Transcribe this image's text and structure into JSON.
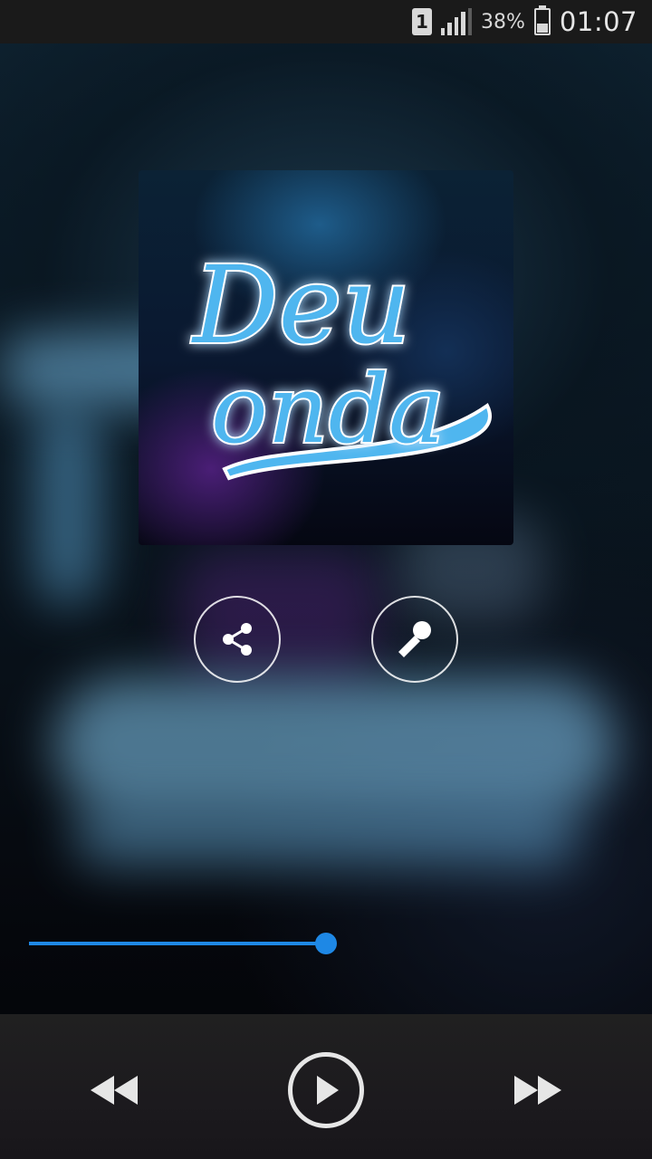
{
  "status_bar": {
    "sim_slot": "1",
    "battery_percent": "38%",
    "time": "01:07"
  },
  "album": {
    "art_title_line1": "Deu",
    "art_title_line2": "onda",
    "accent_color": "#4fb6ef"
  },
  "actions": {
    "share_icon": "share-icon",
    "lyrics_icon": "microphone-icon"
  },
  "playback": {
    "progress_fraction": 0.5,
    "state": "paused",
    "accent_color": "#1e88e5"
  },
  "controls": {
    "rewind_icon": "rewind-icon",
    "play_icon": "play-icon",
    "forward_icon": "fast-forward-icon"
  }
}
